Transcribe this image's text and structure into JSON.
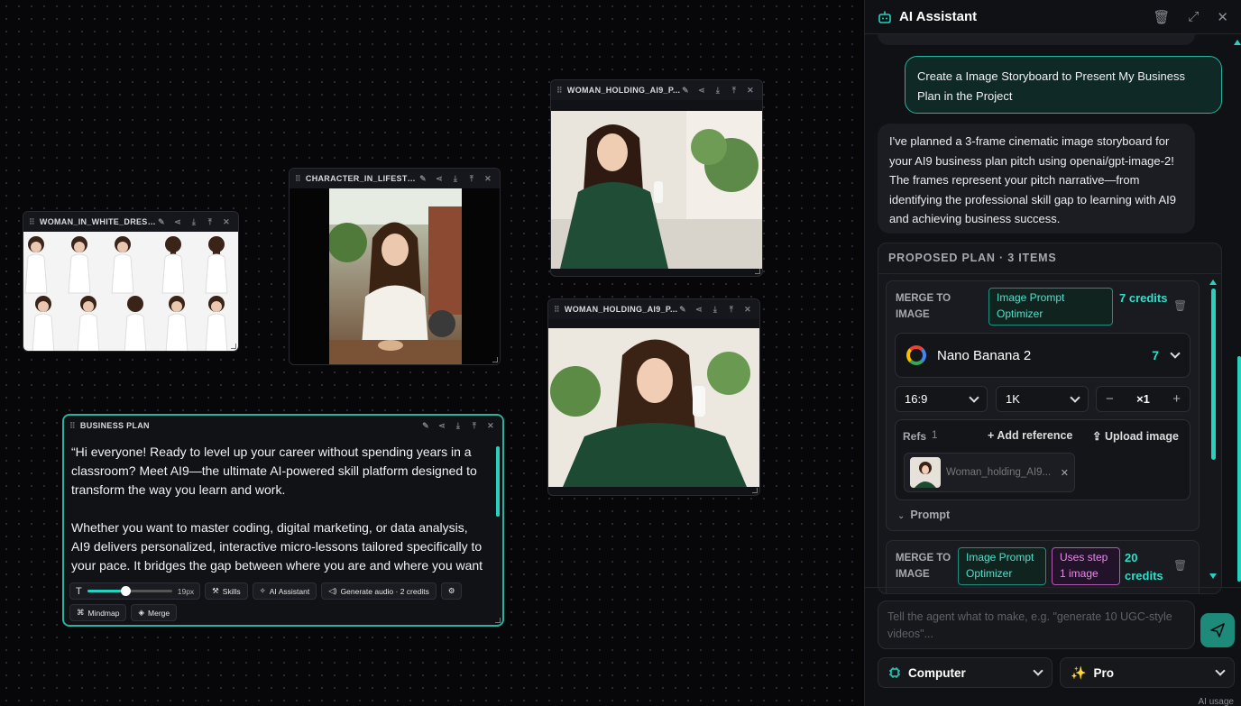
{
  "canvas": {
    "nodes": {
      "white_dress": {
        "title": "WOMAN_IN_WHITE_DRESS_..."
      },
      "lifestyle": {
        "title": "CHARACTER_IN_LIFESTYLE..."
      },
      "holding_1": {
        "title": "WOMAN_HOLDING_AI9_P..."
      },
      "holding_2": {
        "title": "WOMAN_HOLDING_AI9_P..."
      },
      "business_plan": {
        "title": "BUSINESS PLAN",
        "paragraph_1": "“Hi everyone! Ready to level up your career without spending years in a classroom? Meet AI9—the ultimate AI-powered skill platform designed to transform the way you learn and work.",
        "paragraph_2": "Whether you want to master coding, digital marketing, or data analysis, AI9 delivers personalized, interactive micro-lessons tailored specifically to your pace. It bridges the gap between where you are and where you want",
        "font_size_label": "19px",
        "font_size_value": 19,
        "font_size_slider_fraction": 0.45,
        "skills_label": "Skills",
        "ai_assistant_label": "AI Assistant",
        "generate_audio_label": "Generate audio · 2 credits",
        "mindmap_label": "Mindmap",
        "merge_label": "Merge"
      }
    }
  },
  "panel": {
    "title": "AI Assistant",
    "user_message": "Create a Image Storyboard to Present My Business Plan in the Project",
    "ai_message": "I've planned a 3-frame cinematic image storyboard for your AI9 business plan pitch using openai/gpt-image-2! The frames represent your pitch narrative—from identifying the professional skill gap to learning with AI9 and achieving business success.",
    "plan": {
      "title": "PROPOSED PLAN · 3 ITEMS",
      "step1": {
        "label": "MERGE TO IMAGE",
        "tag": "Image Prompt Optimizer",
        "credits": "7 credits",
        "model_name": "Nano Banana 2",
        "model_count": "7",
        "aspect": "16:9",
        "resolution": "1K",
        "multiplier": "×1",
        "refs_label": "Refs",
        "refs_count": "1",
        "add_reference": "Add reference",
        "upload_image": "Upload image",
        "ref_name": "Woman_holding_AI9...",
        "prompt_label": "Prompt"
      },
      "step2": {
        "label": "MERGE TO IMAGE",
        "tag": "Image Prompt Optimizer",
        "tag2": "Uses step 1 image",
        "credits": "20 credits"
      }
    },
    "input_placeholder": "Tell the agent what to make, e.g. \"generate 10 UGC-style videos\"...",
    "computer_label": "Computer",
    "pro_label": "Pro",
    "footer_text": "AI usage"
  },
  "colors": {
    "accent": "#27d1bf",
    "pink": "#e48ce4",
    "background": "#07070a"
  }
}
